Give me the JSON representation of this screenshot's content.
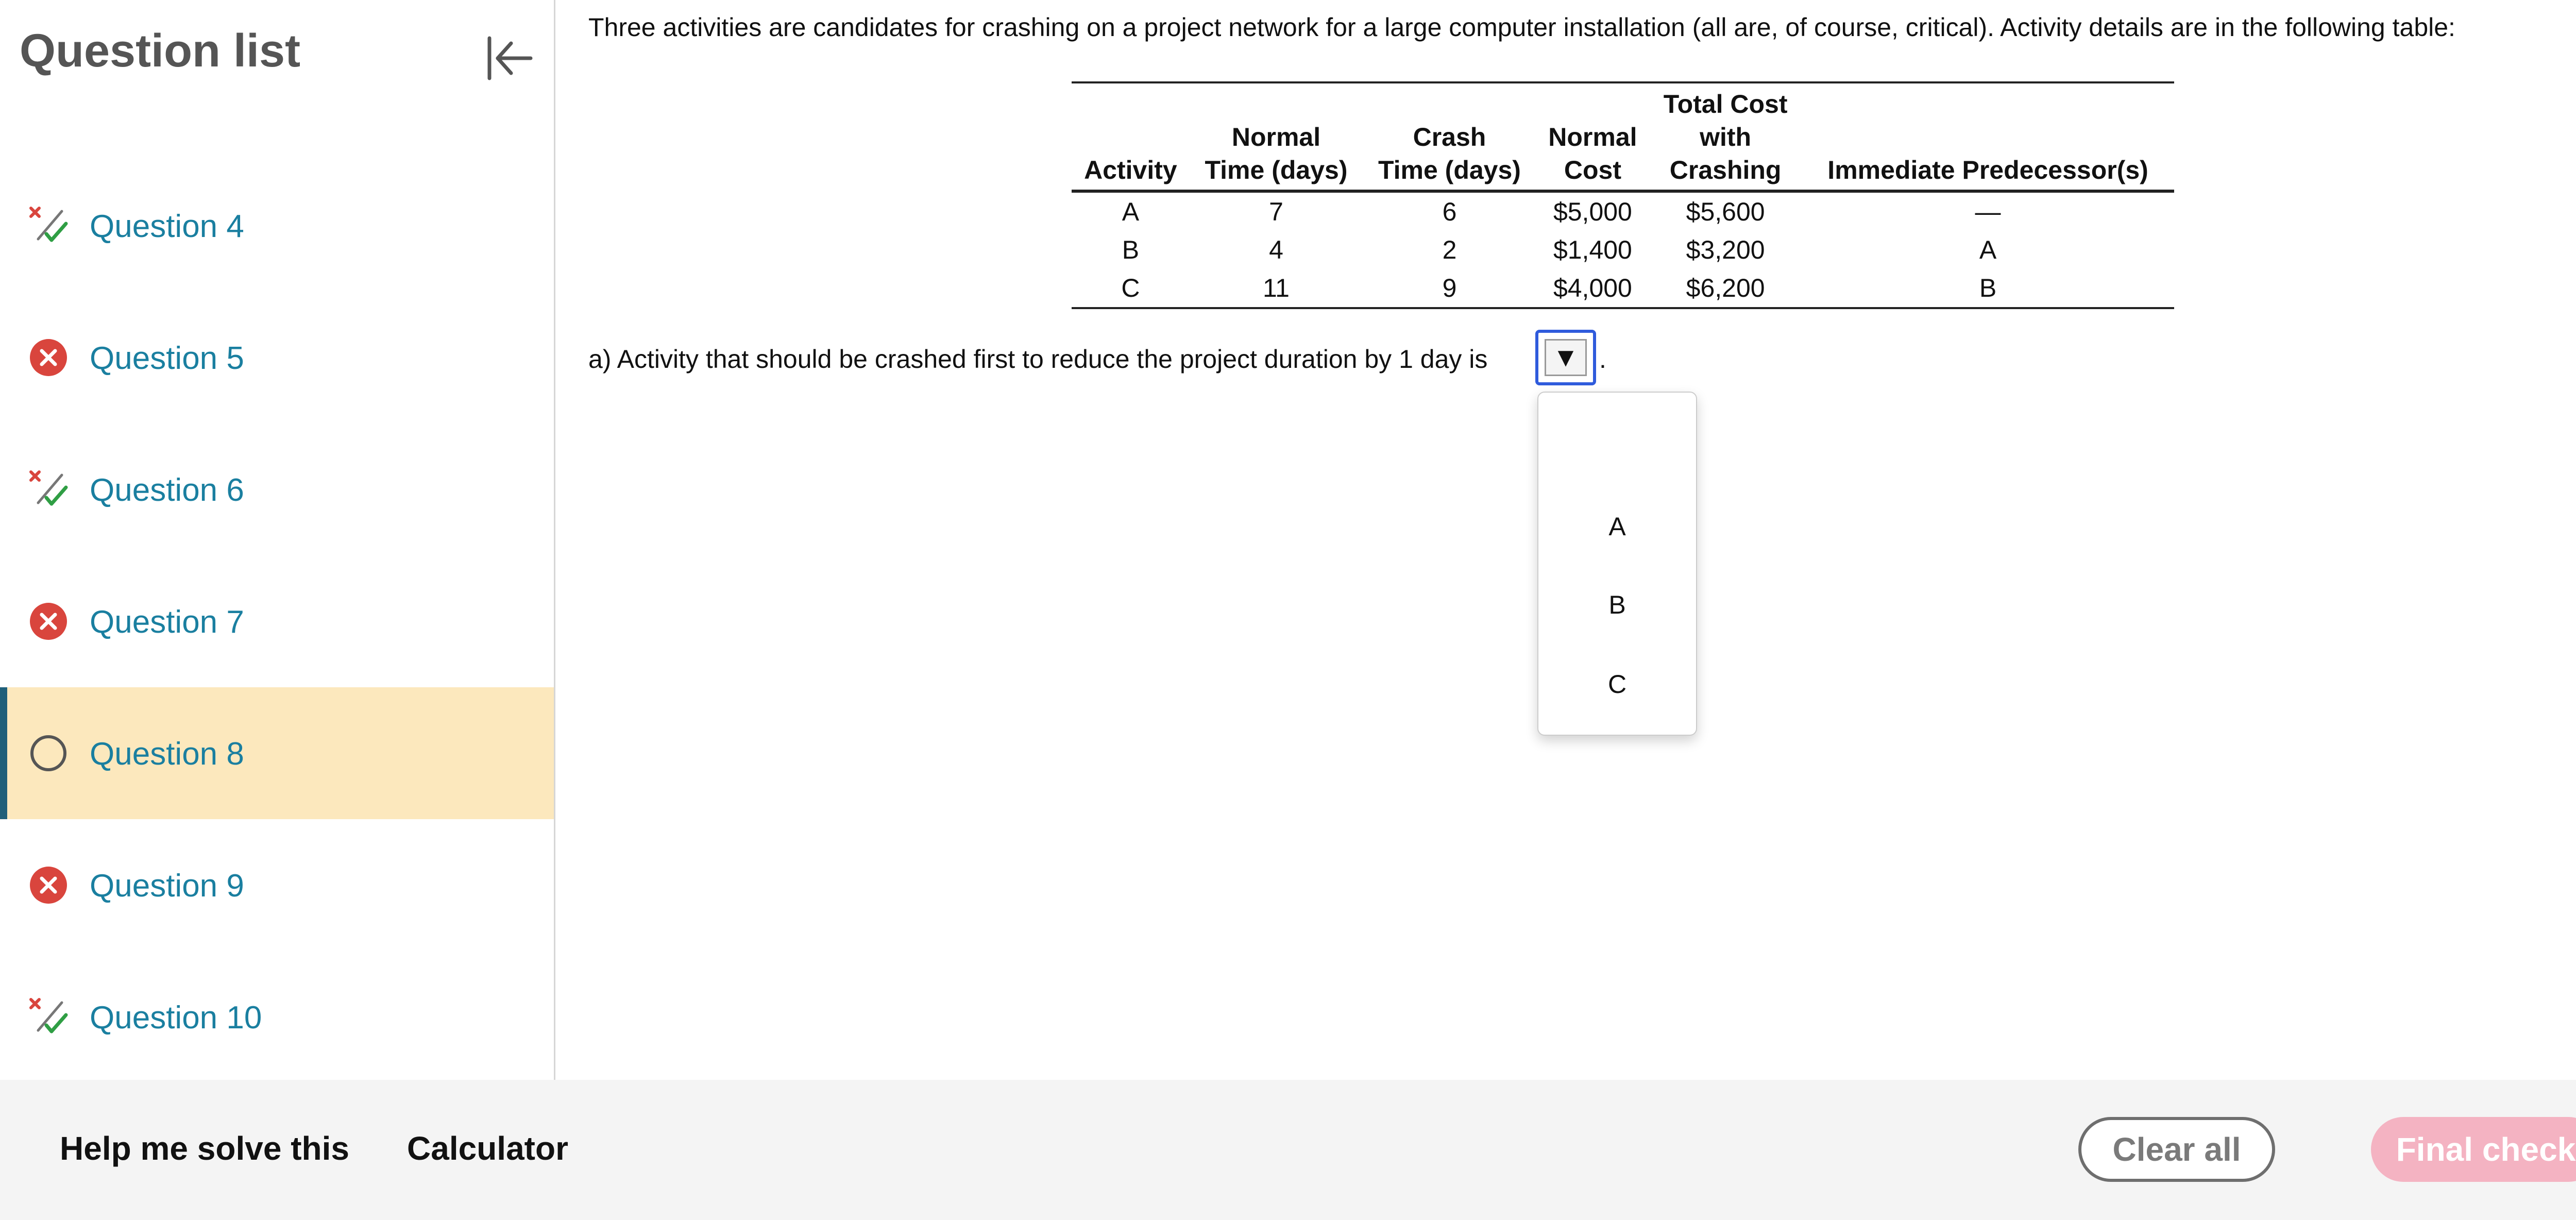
{
  "sidebar": {
    "title": "Question list",
    "items": [
      {
        "label": "Question 4",
        "status": "partial",
        "icon": "partial-credit-icon"
      },
      {
        "label": "Question 5",
        "status": "incorrect",
        "icon": "incorrect-icon"
      },
      {
        "label": "Question 6",
        "status": "partial",
        "icon": "partial-credit-icon"
      },
      {
        "label": "Question 7",
        "status": "incorrect",
        "icon": "incorrect-icon"
      },
      {
        "label": "Question 8",
        "status": "current",
        "icon": "unanswered-circle-icon"
      },
      {
        "label": "Question 9",
        "status": "incorrect",
        "icon": "incorrect-icon"
      },
      {
        "label": "Question 10",
        "status": "partial",
        "icon": "partial-credit-icon"
      }
    ]
  },
  "main": {
    "intro": "Three activities are candidates for crashing on a project network for a large computer installation (all are, of course, critical). Activity details are in the following table:",
    "table": {
      "headers": [
        [
          "Activity"
        ],
        [
          "Normal",
          "Time (days)"
        ],
        [
          "Crash",
          "Time (days)"
        ],
        [
          "Normal",
          "Cost"
        ],
        [
          "Total Cost",
          "with",
          "Crashing"
        ],
        [
          "Immediate Predecessor(s)"
        ]
      ],
      "rows": [
        [
          "A",
          "7",
          "6",
          "$5,000",
          "$5,600",
          "—"
        ],
        [
          "B",
          "4",
          "2",
          "$1,400",
          "$3,200",
          "A"
        ],
        [
          "C",
          "11",
          "9",
          "$4,000",
          "$6,200",
          "B"
        ]
      ]
    },
    "question": {
      "text": "a) Activity that should be crashed first to reduce the project duration by 1 day is",
      "period": ".",
      "dropdown_arrow": "▼",
      "options": [
        "A",
        "B",
        "C"
      ]
    }
  },
  "footer": {
    "help_label": "Help me solve this",
    "calculator_label": "Calculator",
    "clear_all_label": "Clear all",
    "final_check_label": "Final check"
  },
  "colors": {
    "link": "#1a7fa0",
    "active_bg": "#fce8bd",
    "active_bar": "#1f5f7a",
    "incorrect": "#d9453d",
    "correct_check": "#2f9e44",
    "dropdown_focus": "#2f5bdc",
    "final_check_bg": "#f4b3c2"
  }
}
